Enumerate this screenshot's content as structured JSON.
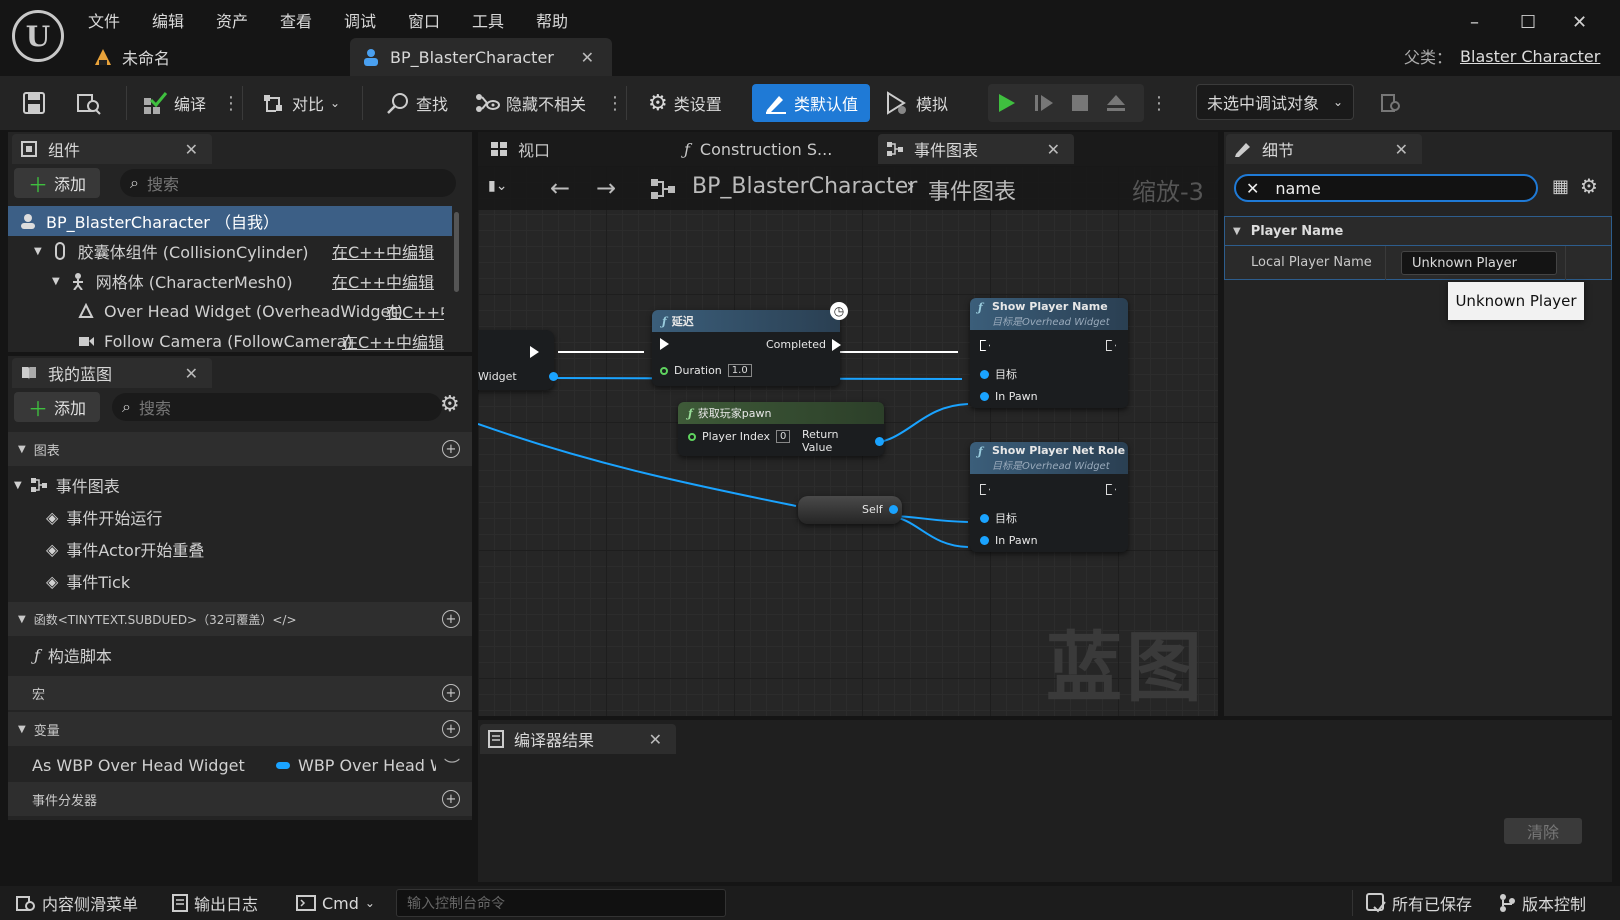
{
  "app": {
    "logo_text": "U"
  },
  "menu": [
    "文件",
    "编辑",
    "资产",
    "查看",
    "调试",
    "窗口",
    "工具",
    "帮助"
  ],
  "doc_tabs": [
    {
      "label": "未命名"
    },
    {
      "label": "BP_BlasterCharacter"
    }
  ],
  "parent_class": {
    "label": "父类：",
    "value": "Blaster Character"
  },
  "window_controls": {
    "minimize": "–",
    "maximize": "☐",
    "close": "✕"
  },
  "toolbar": {
    "compile": "编译",
    "diff": "对比",
    "find": "查找",
    "hide_unrelated": "隐藏不相关",
    "class_settings": "类设置",
    "class_defaults": "类默认值",
    "simulate": "模拟",
    "debug_target": "未选中调试对象"
  },
  "components_panel": {
    "title": "组件",
    "add": "添加",
    "search_placeholder": "搜索",
    "items": [
      {
        "label": "BP_BlasterCharacter （自我）"
      },
      {
        "label": "胶囊体组件 (CollisionCylinder)",
        "edit": "在C++中编辑"
      },
      {
        "label": "网格体 (CharacterMesh0)",
        "edit": "在C++中编辑"
      },
      {
        "label": "Over Head Widget (OverheadWidget)",
        "edit": "在C++中编辑"
      },
      {
        "label": "Follow Camera (FollowCamera)",
        "edit": "在C++中编辑"
      }
    ]
  },
  "my_blueprint": {
    "title": "我的蓝图",
    "add": "添加",
    "search_placeholder": "搜索",
    "graphs_header": "图表",
    "event_graph": "事件图表",
    "events": [
      "事件开始运行",
      "事件Actor开始重叠",
      "事件Tick"
    ],
    "functions_header": "函数<TINYTEXT.SUBDUED>（32可覆盖）</>",
    "construction_script": "构造脚本",
    "macros_header": "宏",
    "variables_header": "变量",
    "variable": {
      "name": "As WBP Over Head Widget",
      "type": "WBP Over Head W"
    },
    "dispatchers_header": "事件分发器"
  },
  "graph_tabs": {
    "viewport": "视口",
    "construction": "Construction S...",
    "event_graph": "事件图表"
  },
  "graph_toolbar": {
    "breadcrumb_root": "BP_BlasterCharacter",
    "breadcrumb_leaf": "事件图表",
    "zoom": "缩放-3"
  },
  "nodes": {
    "partial_pin": "Widget",
    "delay": {
      "title": "延迟",
      "completed": "Completed",
      "duration_label": "Duration",
      "duration_value": "1.0"
    },
    "get_pawn": {
      "title": "获取玩家pawn",
      "player_index_label": "Player Index",
      "player_index_value": "0",
      "return_value": "Return Value"
    },
    "self": {
      "label": "Self"
    },
    "show_name": {
      "title": "Show Player Name",
      "subtitle": "目标是Overhead Widget",
      "target": "目标",
      "in_pawn": "In Pawn"
    },
    "show_role": {
      "title": "Show Player Net Role",
      "subtitle": "目标是Overhead Widget",
      "target": "目标",
      "in_pawn": "In Pawn"
    }
  },
  "watermark": "蓝图",
  "compiler": {
    "title": "编译器结果",
    "clear": "清除"
  },
  "details": {
    "title": "细节",
    "search_value": "name",
    "category": "Player Name",
    "property_label": "Local Player Name",
    "property_value": "Unknown Player",
    "tooltip": "Unknown Player"
  },
  "status": {
    "content_drawer": "内容侧滑菜单",
    "output_log": "输出日志",
    "cmd": "Cmd",
    "console_placeholder": "输入控制台命令",
    "all_saved": "所有已保存",
    "source_control": "版本控制"
  },
  "colors": {
    "accent": "#1f7ad6",
    "play": "#3fbf3f",
    "pin_blue": "#1aa3ff",
    "function_header": "#3b5e7a",
    "pure_header": "#3e5a38"
  }
}
